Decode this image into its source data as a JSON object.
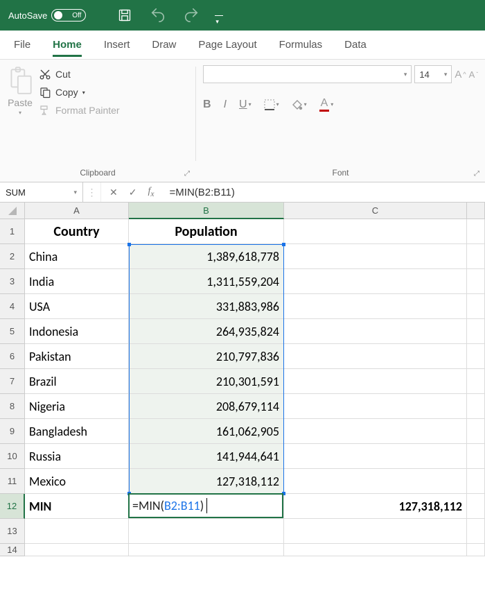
{
  "titlebar": {
    "autosave_label": "AutoSave",
    "autosave_state": "Off"
  },
  "tabs": [
    "File",
    "Home",
    "Insert",
    "Draw",
    "Page Layout",
    "Formulas",
    "Data"
  ],
  "active_tab": "Home",
  "ribbon": {
    "paste_label": "Paste",
    "cut_label": "Cut",
    "copy_label": "Copy",
    "format_painter_label": "Format Painter",
    "clipboard_group": "Clipboard",
    "font_group": "Font",
    "font_size": "14",
    "font_name": ""
  },
  "name_box": "SUM",
  "formula_bar": "=MIN(B2:B11)",
  "columns": [
    "A",
    "B",
    "C"
  ],
  "rows": [
    {
      "n": 1,
      "A": "Country",
      "B": "Population",
      "C": "",
      "bold": true,
      "header": true
    },
    {
      "n": 2,
      "A": "China",
      "B": "1,389,618,778",
      "C": ""
    },
    {
      "n": 3,
      "A": "India",
      "B": "1,311,559,204",
      "C": ""
    },
    {
      "n": 4,
      "A": "USA",
      "B": "331,883,986",
      "C": ""
    },
    {
      "n": 5,
      "A": "Indonesia",
      "B": "264,935,824",
      "C": ""
    },
    {
      "n": 6,
      "A": "Pakistan",
      "B": "210,797,836",
      "C": ""
    },
    {
      "n": 7,
      "A": "Brazil",
      "B": "210,301,591",
      "C": ""
    },
    {
      "n": 8,
      "A": "Nigeria",
      "B": "208,679,114",
      "C": ""
    },
    {
      "n": 9,
      "A": "Bangladesh",
      "B": "161,062,905",
      "C": ""
    },
    {
      "n": 10,
      "A": "Russia",
      "B": "141,944,641",
      "C": ""
    },
    {
      "n": 11,
      "A": "Mexico",
      "B": "127,318,112",
      "C": ""
    },
    {
      "n": 12,
      "A": "MIN",
      "B": "=MIN(B2:B11)",
      "C": "127,318,112",
      "bold": true
    },
    {
      "n": 13,
      "A": "",
      "B": "",
      "C": ""
    }
  ],
  "active_cell": "B12",
  "active_formula_parts": {
    "pre": "=MIN(",
    "arg": "B2:B11",
    "post": ")"
  },
  "selection_range": "B2:B11"
}
